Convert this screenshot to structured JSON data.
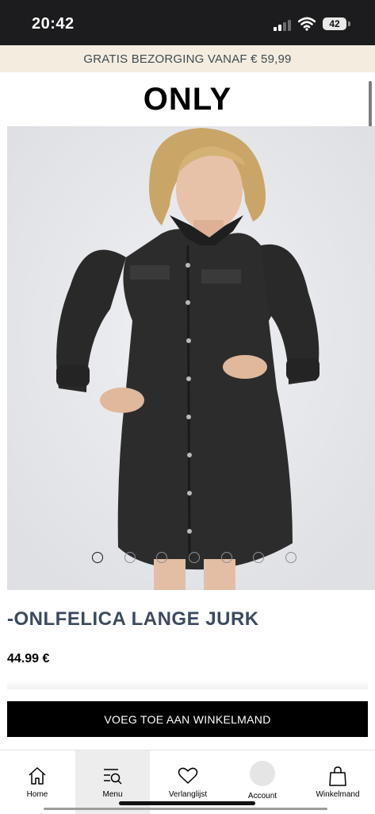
{
  "status_bar": {
    "time": "20:42",
    "battery": "42"
  },
  "promo_banner": {
    "text": "GRATIS BEZORGING VANAF € 59,99"
  },
  "header": {
    "logo": "ONLY"
  },
  "product": {
    "image_alt": "Black denim shirt dress worn by model",
    "title": "-ONLFELICA LANGE JURK",
    "price": "44.99 €",
    "carousel": {
      "total": 7,
      "active_index": 0
    }
  },
  "actions": {
    "add_to_cart_label": "VOEG TOE AAN WINKELMAND"
  },
  "bottom_nav": {
    "items": [
      {
        "label": "Home",
        "icon": "home-icon"
      },
      {
        "label": "Menu",
        "icon": "menu-search-icon",
        "active": true
      },
      {
        "label": "Verlanglijst",
        "icon": "heart-icon"
      },
      {
        "label": "Account",
        "icon": "avatar"
      },
      {
        "label": "Winkelmand",
        "icon": "shopping-bag-icon"
      }
    ]
  },
  "colors": {
    "banner_bg": "#f4ecdf",
    "title_text": "#3c4b5e",
    "cta_bg": "#000000",
    "image_bg": "#e4e5e8"
  }
}
